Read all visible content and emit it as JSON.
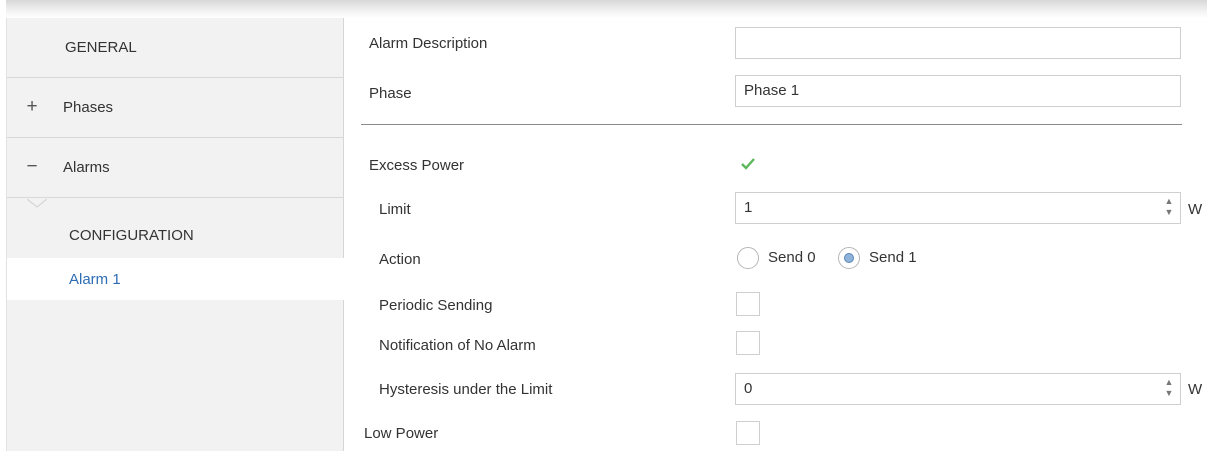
{
  "sidebar": {
    "general": "GENERAL",
    "phases": {
      "sign": "+",
      "label": "Phases"
    },
    "alarms": {
      "sign": "−",
      "label": "Alarms"
    },
    "configuration": "CONFIGURATION",
    "alarm1": "Alarm 1"
  },
  "form": {
    "alarm_description": {
      "label": "Alarm Description",
      "value": ""
    },
    "phase": {
      "label": "Phase",
      "value": "Phase 1"
    },
    "excess_power": {
      "label": "Excess Power",
      "checked": true
    },
    "limit": {
      "label": "Limit",
      "value": "1",
      "unit": "W"
    },
    "action": {
      "label": "Action",
      "options": [
        "Send 0",
        "Send 1"
      ],
      "selected": "Send 1"
    },
    "periodic_sending": {
      "label": "Periodic Sending",
      "checked": false
    },
    "notification_no_alarm": {
      "label": "Notification of No Alarm",
      "checked": false
    },
    "hysteresis": {
      "label": "Hysteresis under the Limit",
      "value": "0",
      "unit": "W"
    },
    "low_power": {
      "label": "Low Power",
      "checked": false
    }
  },
  "colors": {
    "selected_text": "#2e6db4",
    "check": "#5cb85c",
    "sidebar_bg": "#f2f2f2"
  }
}
